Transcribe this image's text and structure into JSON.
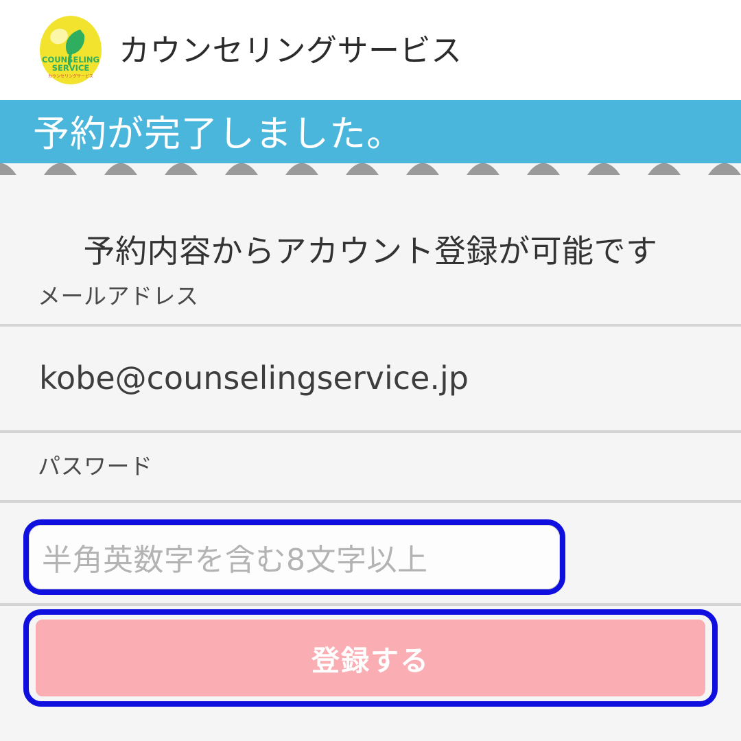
{
  "header": {
    "logo": {
      "icon_name": "counseling-service-logo",
      "primary_text": "COUNSELING",
      "secondary_text": "SERVICE",
      "kana_text": "カウンセリングサービス",
      "oval_color": "#f2e42e",
      "leaf_color": "#2fae60",
      "text_color": "#2fae60"
    },
    "title": "カウンセリングサービス"
  },
  "banner": {
    "message": "予約が完了しました。",
    "background_color": "#4bb6db",
    "text_color": "#ffffff",
    "wave_color": "#9a9a9a"
  },
  "main": {
    "heading": "予約内容からアカウント登録が可能です",
    "fields": [
      {
        "id": "email",
        "label": "メールアドレス",
        "value": "kobe@counselingservice.jp",
        "placeholder": "",
        "focused": false
      },
      {
        "id": "password",
        "label": "パスワード",
        "value": "",
        "placeholder": "半角英数字を含む8文字以上",
        "focused": true
      }
    ],
    "submit": {
      "label": "登録する",
      "background_color": "#faadb2",
      "text_color": "#ffffff",
      "focused": true
    },
    "focus_ring_color": "#0f0fe0",
    "background_color": "#f5f5f5",
    "divider_color": "#d4d4d4"
  }
}
